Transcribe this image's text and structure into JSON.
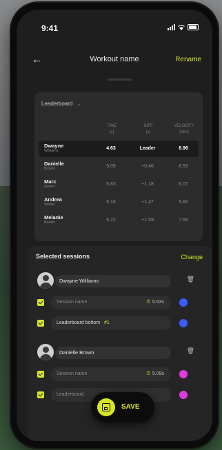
{
  "status": {
    "time": "9:41"
  },
  "nav": {
    "title": "Workout name",
    "rename": "Rename"
  },
  "leaderboard": {
    "selector": "Leaderboard",
    "columns": [
      {
        "title": "TIME",
        "unit": "(s)"
      },
      {
        "title": "DIFF",
        "unit": "(s)"
      },
      {
        "title": "VELOCITY",
        "unit": "(m/s)"
      }
    ],
    "rows": [
      {
        "first": "Dwayne",
        "last": "Williams",
        "time": "4.63",
        "diff": "Leader",
        "velocity": "6.96"
      },
      {
        "first": "Danielle",
        "last": "Brown",
        "time": "5.09",
        "diff": "+0.46",
        "velocity": "6.53"
      },
      {
        "first": "Marc",
        "last": "Green",
        "time": "5.83",
        "diff": "+1.18",
        "velocity": "6.07"
      },
      {
        "first": "Andrea",
        "last": "Wilder",
        "time": "6.10",
        "diff": "+1.47",
        "velocity": "5.82"
      },
      {
        "first": "Melanie",
        "last": "Baxter",
        "time": "6.22",
        "diff": "+1.59",
        "velocity": "7.66"
      }
    ]
  },
  "sessions": {
    "title": "Selected sessions",
    "change": "Change",
    "people": [
      {
        "name": "Dwayne Williams",
        "items": [
          {
            "label": "Session name",
            "tag": "",
            "duration": "5.63s",
            "color": "#3b5bff"
          },
          {
            "label": "Leaderboard bottom",
            "tag": "#1",
            "duration": "",
            "color": "#3b5bff"
          }
        ]
      },
      {
        "name": "Danielle Brown",
        "items": [
          {
            "label": "Session name",
            "tag": "",
            "duration": "5.09s",
            "color": "#e23bdc"
          },
          {
            "label": "Leaderboard",
            "tag": "",
            "duration": "",
            "color": "#e23bdc"
          }
        ]
      }
    ]
  },
  "save": {
    "label": "SAVE"
  }
}
